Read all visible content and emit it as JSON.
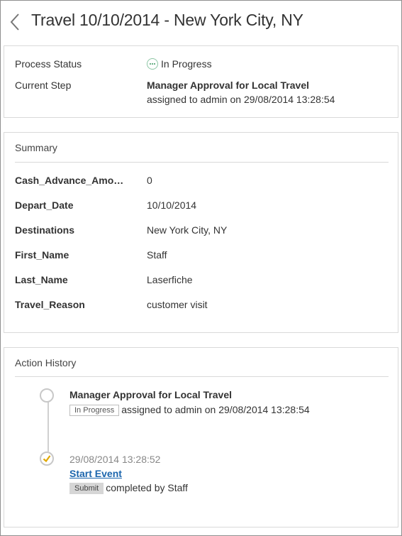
{
  "header": {
    "title": "Travel 10/10/2014 - New York City, NY"
  },
  "process": {
    "status_label": "Process Status",
    "status_value": "In Progress",
    "step_label": "Current Step",
    "step_name": "Manager Approval for Local Travel",
    "step_detail": "assigned to admin on 29/08/2014 13:28:54"
  },
  "summary": {
    "title": "Summary",
    "rows": [
      {
        "key": "Cash_Advance_Amo…",
        "value": "0"
      },
      {
        "key": "Depart_Date",
        "value": "10/10/2014"
      },
      {
        "key": "Destinations",
        "value": "New York City, NY"
      },
      {
        "key": "First_Name",
        "value": "Staff"
      },
      {
        "key": "Last_Name",
        "value": "Laserfiche"
      },
      {
        "key": "Travel_Reason",
        "value": "customer visit"
      }
    ]
  },
  "history": {
    "title": "Action History",
    "items": [
      {
        "title": "Manager Approval for Local Travel",
        "tag": "In Progress",
        "detail": "assigned to admin on 29/08/2014 13:28:54"
      },
      {
        "timestamp": "29/08/2014 13:28:52",
        "title": "Start Event",
        "tag": "Submit",
        "detail": "completed by Staff"
      }
    ]
  },
  "colors": {
    "accent_link": "#1b65ad",
    "check_color": "#e0a800",
    "status_color": "#3c9a63"
  }
}
